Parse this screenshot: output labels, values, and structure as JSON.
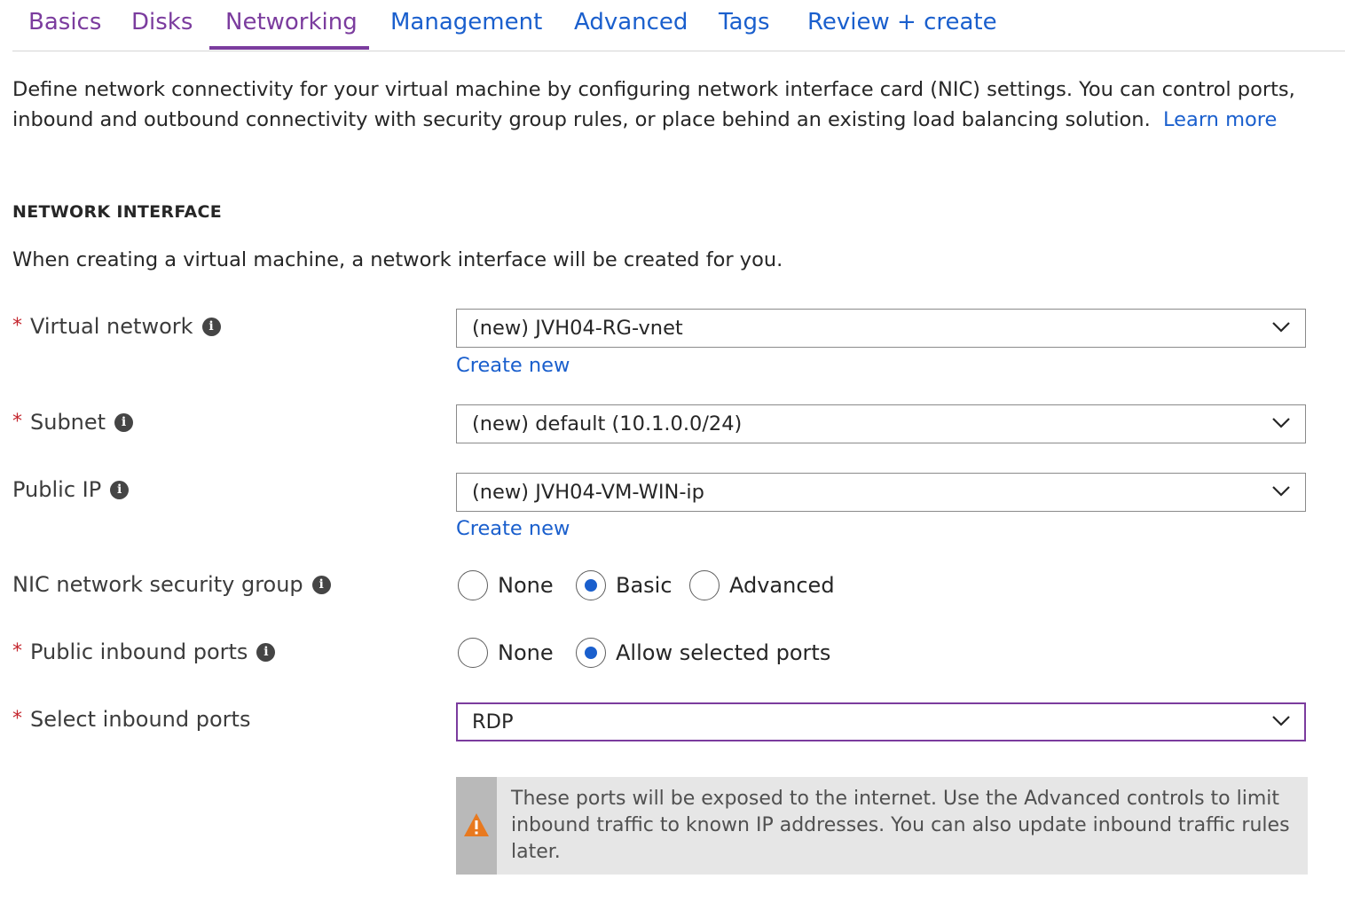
{
  "tabs": [
    {
      "label": "Basics",
      "state": "visited"
    },
    {
      "label": "Disks",
      "state": "visited"
    },
    {
      "label": "Networking",
      "state": "active"
    },
    {
      "label": "Management",
      "state": "default"
    },
    {
      "label": "Advanced",
      "state": "default"
    },
    {
      "label": "Tags",
      "state": "default"
    },
    {
      "label": "Review + create",
      "state": "default"
    }
  ],
  "description": {
    "text": "Define network connectivity for your virtual machine by configuring network interface card (NIC) settings. You can control ports, inbound and outbound connectivity with security group rules, or place behind an existing load balancing solution.",
    "link": "Learn more"
  },
  "section": {
    "title": "NETWORK INTERFACE",
    "subtext": "When creating a virtual machine, a network interface will be created for you."
  },
  "fields": {
    "virtual_network": {
      "label": "Virtual network",
      "required": "*",
      "value": "(new) JVH04-RG-vnet",
      "link": "Create new"
    },
    "subnet": {
      "label": "Subnet",
      "required": "*",
      "value": "(new) default (10.1.0.0/24)"
    },
    "public_ip": {
      "label": "Public IP",
      "value": "(new) JVH04-VM-WIN-ip",
      "link": "Create new"
    },
    "nic_nsg": {
      "label": "NIC network security group",
      "options": [
        "None",
        "Basic",
        "Advanced"
      ],
      "selected": "Basic"
    },
    "public_inbound_ports": {
      "label": "Public inbound ports",
      "required": "*",
      "options": [
        "None",
        "Allow selected ports"
      ],
      "selected": "Allow selected ports"
    },
    "select_inbound_ports": {
      "label": "Select inbound ports",
      "required": "*",
      "value": "RDP"
    }
  },
  "info_icon_glyph": "i",
  "warning": {
    "icon": "warning-icon",
    "text": "These ports will be exposed to the internet. Use the Advanced controls to limit inbound traffic to known IP addresses. You can also update inbound traffic rules later."
  },
  "colors": {
    "link": "#1a5fcd",
    "accent_purple": "#7b3c9e",
    "required_red": "#c4262e",
    "warning_orange": "#e8791f",
    "radio_dot": "#1a5fcd"
  }
}
